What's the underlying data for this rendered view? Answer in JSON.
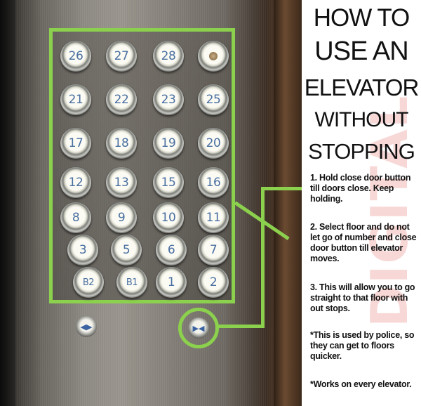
{
  "title": {
    "line1": "HOW TO",
    "line2": "USE AN",
    "line3": "ELEVATOR",
    "line4": "WITHOUT",
    "line5": "STOPPING"
  },
  "steps": [
    "1. Hold close door button till doors close. Keep holding.",
    "2. Select floor and do not let go of number and close door button till elevator moves.",
    "3. This will allow you to go straight to that floor with out stops.",
    "*This is used by police, so they can get to floors quicker.",
    "*Works on every elevator."
  ],
  "watermark": "DIGITAL",
  "panel": {
    "rows": [
      [
        "26",
        "27",
        "28",
        ""
      ],
      [
        "21",
        "22",
        "23",
        "25"
      ],
      [
        "17",
        "18",
        "19",
        "20"
      ],
      [
        "12",
        "13",
        "15",
        "16"
      ],
      [
        "8",
        "9",
        "10",
        "11"
      ],
      [
        "3",
        "5",
        "6",
        "7"
      ],
      [
        "B2",
        "B1",
        "1",
        "2"
      ]
    ],
    "open_door_symbol": "◀▶",
    "close_door_symbol": "▶◀"
  },
  "colors": {
    "highlight": "#8cd14e",
    "button_text": "#4a6fa0",
    "watermark": "#f6cfcd"
  }
}
